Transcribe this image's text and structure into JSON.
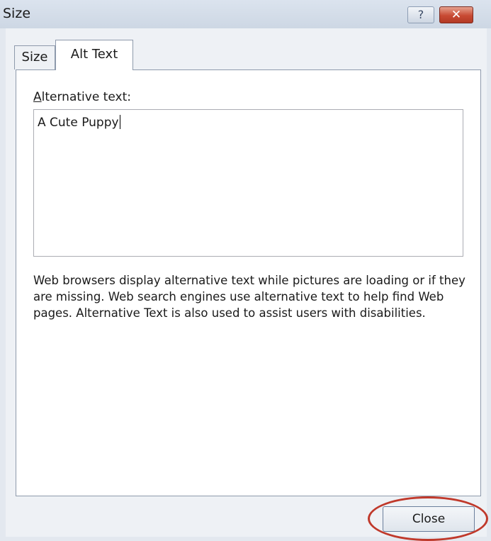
{
  "window": {
    "title": "Size",
    "help_symbol": "?",
    "close_symbol": "✕"
  },
  "tabs": [
    {
      "label": "Size",
      "active": false
    },
    {
      "label": "Alt Text",
      "active": true
    }
  ],
  "alt_text": {
    "label_access_key": "A",
    "label_rest": "lternative text:",
    "value": "A Cute Puppy",
    "help_text": "Web browsers display alternative text while pictures are loading or if they are missing.  Web search engines use alternative text to help find Web pages.  Alternative Text is also used to assist users with disabilities."
  },
  "buttons": {
    "close_label": "Close"
  },
  "colors": {
    "highlight_ring": "#c0392b"
  }
}
